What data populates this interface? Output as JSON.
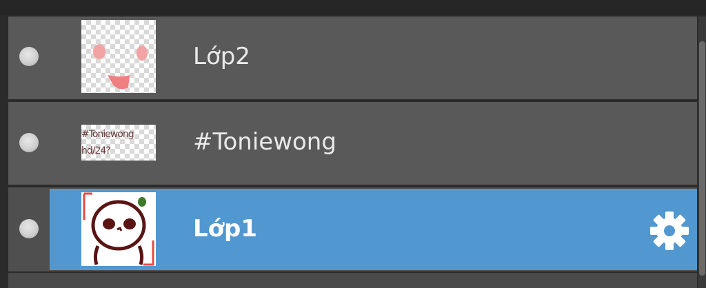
{
  "layers": [
    {
      "name": "Lớp2",
      "thumbnail": "pink-face-layer",
      "visible": true,
      "selected": false
    },
    {
      "name": "#Toniewong",
      "thumbnail": "text-layer",
      "thumbnail_text": [
        "#Toniewong",
        "hd/24?"
      ],
      "visible": true,
      "selected": false
    },
    {
      "name": "Lớp1",
      "thumbnail": "character-drawing",
      "visible": true,
      "selected": true,
      "settings_icon": "gear-icon"
    }
  ],
  "colors": {
    "selected": "#5198d1",
    "row": "#595959",
    "background": "#2b2b2b"
  }
}
